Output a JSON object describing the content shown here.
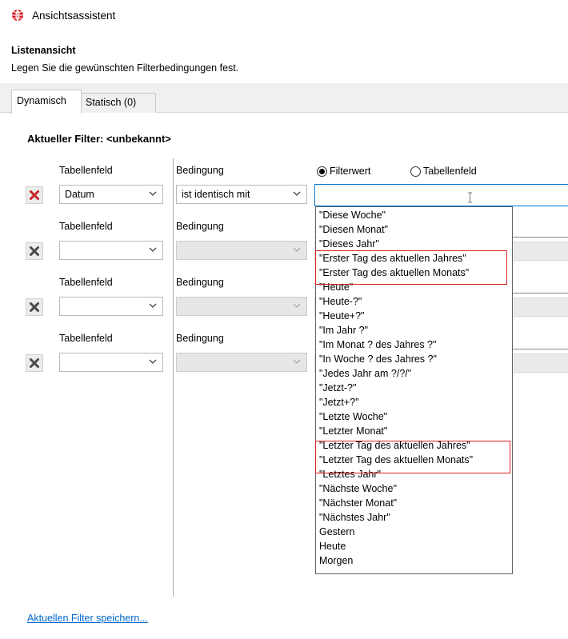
{
  "window": {
    "title": "Ansichtsassistent",
    "app_icon": "globe-icon",
    "icon_color": "#d9242a"
  },
  "header": {
    "title": "Listenansicht",
    "subtitle": "Legen Sie die gewünschten Filterbedingungen fest."
  },
  "tabs": [
    {
      "label": "Dynamisch",
      "active": true
    },
    {
      "label": "Statisch (0)",
      "active": false
    }
  ],
  "filter": {
    "current_label": "Aktueller Filter: <unbekannt>",
    "col_field": "Tabellenfeld",
    "col_condition": "Bedingung",
    "radio_filtervalue": "Filterwert",
    "radio_tablefield": "Tabellenfeld",
    "radio_selected": "Filterwert",
    "value_input": "",
    "rows": [
      {
        "field": "Datum",
        "condition": "ist identisch mit",
        "enabled": true
      },
      {
        "field": "",
        "condition": "",
        "enabled": false
      },
      {
        "field": "",
        "condition": "",
        "enabled": false
      },
      {
        "field": "",
        "condition": "",
        "enabled": false
      }
    ]
  },
  "dropdown": {
    "items": [
      "\"Diese Woche\"",
      "\"Diesen Monat\"",
      "\"Dieses Jahr\"",
      "\"Erster Tag des aktuellen Jahres\"",
      "\"Erster Tag des aktuellen Monats\"",
      "\"Heute\"",
      "\"Heute-?\"",
      "\"Heute+?\"",
      "\"Im Jahr ?\"",
      "\"Im Monat ? des Jahres ?\"",
      "\"In Woche ? des Jahres ?\"",
      "\"Jedes Jahr am ?/?/\"",
      "\"Jetzt-?\"",
      "\"Jetzt+?\"",
      "\"Letzte Woche\"",
      "\"Letzter Monat\"",
      "\"Letzter Tag des aktuellen Jahres\"",
      "\"Letzter Tag des aktuellen Monats\"",
      "\"Letztes Jahr\"",
      "\"Nächste Woche\"",
      "\"Nächster Monat\"",
      "\"Nächstes Jahr\"",
      "Gestern",
      "Heute",
      "Morgen"
    ]
  },
  "footer": {
    "save_link": "Aktuellen Filter speichern..."
  },
  "colors": {
    "delete_active": "#c8252c",
    "delete_inactive": "#4a4a4a",
    "highlight": "#e02020",
    "link": "#0066cc"
  }
}
